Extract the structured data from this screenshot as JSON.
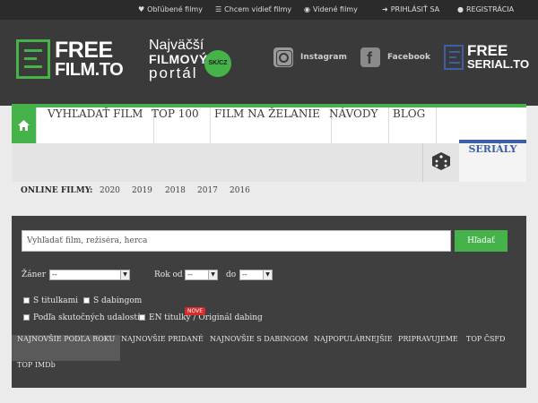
{
  "topbar": {
    "favorites": "Obľúbené filmy",
    "want": "Chcem vidieť filmy",
    "seen": "Videné filmy",
    "login": "PRIHLÁSIŤ SA",
    "register": "REGISTRÁCIA"
  },
  "header": {
    "logo": {
      "line1": "FREE",
      "line2": "FILM.TO"
    },
    "tagline": {
      "l1": "Najväčší",
      "l2": "FILMOVÝ",
      "l3": "portál",
      "badge": "SK/CZ"
    },
    "instagram": "Instagram",
    "facebook": "Facebook",
    "serial_logo": {
      "line1": "FREE",
      "line2": "SERIAL.TO"
    }
  },
  "nav": {
    "items": [
      "VYHĽADAŤ FILM",
      "TOP 100",
      "FILM NA ŽELANIE",
      "NÁVODY",
      "BLOG"
    ],
    "serialy": "SERIÁLY"
  },
  "years": {
    "label": "ONLINE FILMY:",
    "list": [
      "2020",
      "2019",
      "2018",
      "2017",
      "2016"
    ]
  },
  "search": {
    "placeholder": "Vyhľadať film, režiséra, herca",
    "button": "Hľadať",
    "genre_label": "Žáner",
    "genre_value": "--",
    "year_from_label": "Rok od",
    "year_from_value": "--",
    "year_to_label": "do",
    "year_to_value": "--",
    "checks": [
      "S titulkami",
      "S dabingom",
      "Podľa skutočných udalostí",
      "EN titulky / Originál dabing"
    ],
    "new_badge": "NOVE"
  },
  "tabs": [
    "NAJNOVŠIE PODĽA ROKU",
    "NAJNOVŠIE PRIDANÉ",
    "NAJNOVŠIE S DABINGOM",
    "NAJPOPULÁRNEJŠIE",
    "PRIPRAVUJEME",
    "TOP ČSFD",
    "TOP IMDb"
  ],
  "colors": {
    "accent_green": "#45b34a",
    "accent_blue": "#3c5fa8",
    "header_bg": "#3a3a3a",
    "panel_bg": "#3f3f3f"
  }
}
